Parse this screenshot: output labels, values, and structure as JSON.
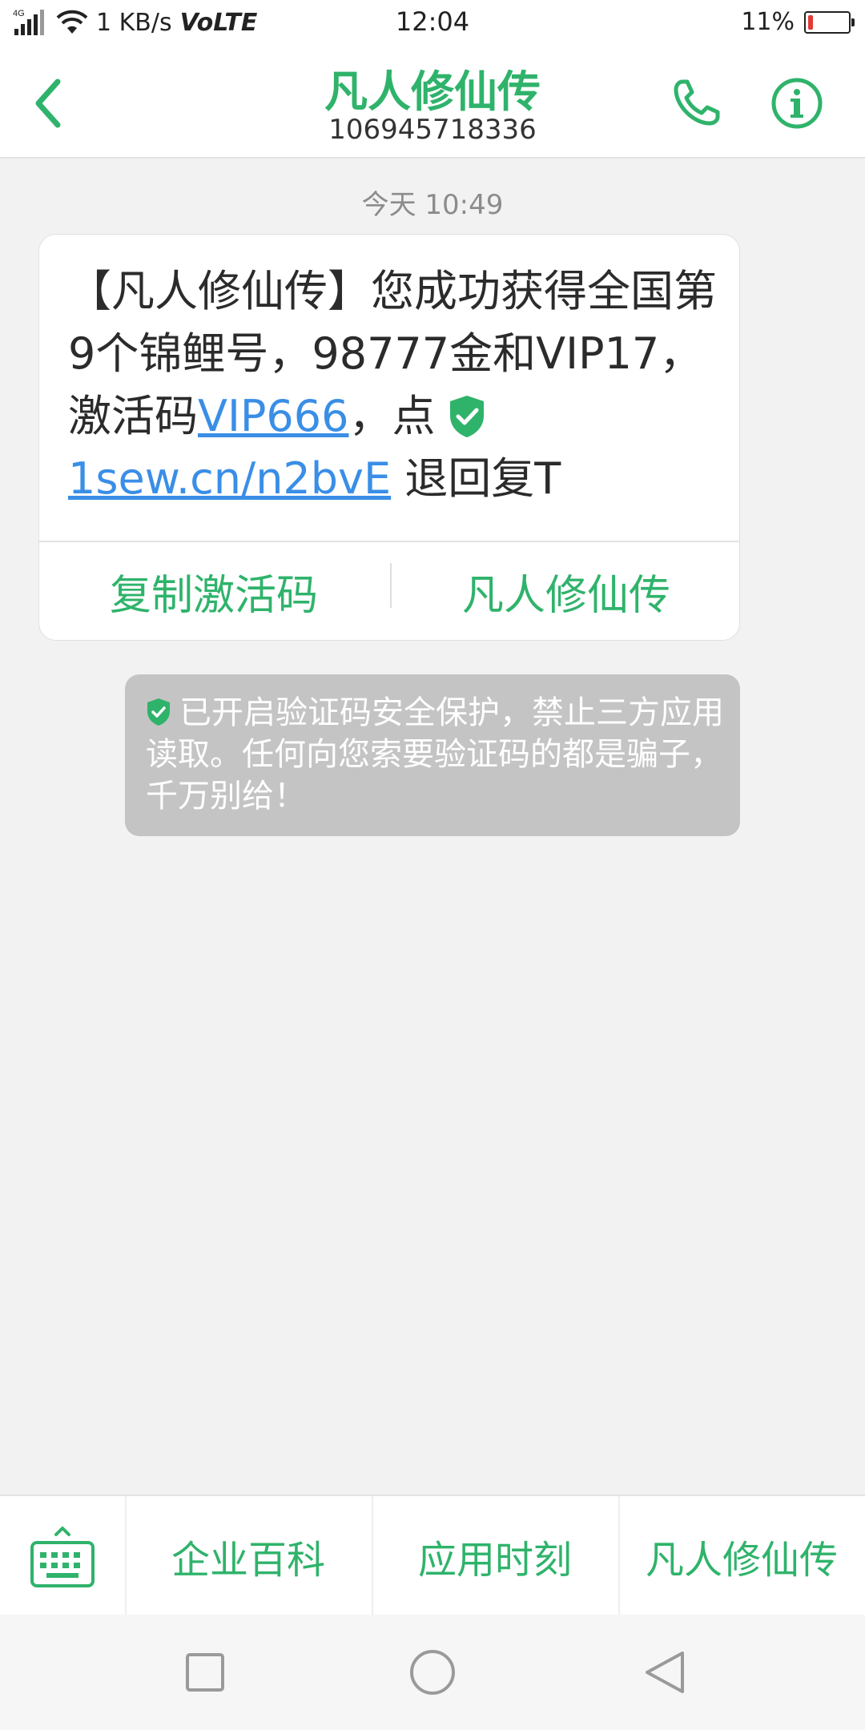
{
  "status_bar": {
    "network": "1 KB/s",
    "volte": "VoLTE",
    "time": "12:04",
    "battery_percent": "11%",
    "battery_level": 0.11,
    "battery_color": "#e53935"
  },
  "header": {
    "title": "凡人修仙传",
    "number": "106945718336",
    "accent": "#2fb36b"
  },
  "conversation": {
    "timestamp": "今天 10:49",
    "message": {
      "text_part1": "【凡人修仙传】您成功获得全国第9个锦鲤号，98777金和VIP17，激活码",
      "link_code": "VIP666",
      "text_part2": "，点",
      "link_url": "1sew.cn/n2bvE",
      "text_part3": " 退回复T",
      "actions": [
        "复制激活码",
        "凡人修仙传"
      ]
    },
    "notice": "已开启验证码安全保护，禁止三方应用读取。任何向您索要验证码的都是骗子，千万别给！"
  },
  "bottom_menu": {
    "items": [
      "企业百科",
      "应用时刻",
      "凡人修仙传"
    ]
  },
  "icons": {
    "back": "chevron-left-icon",
    "phone": "phone-icon",
    "info": "info-icon",
    "shield": "shield-check-icon",
    "keyboard": "keyboard-icon"
  }
}
